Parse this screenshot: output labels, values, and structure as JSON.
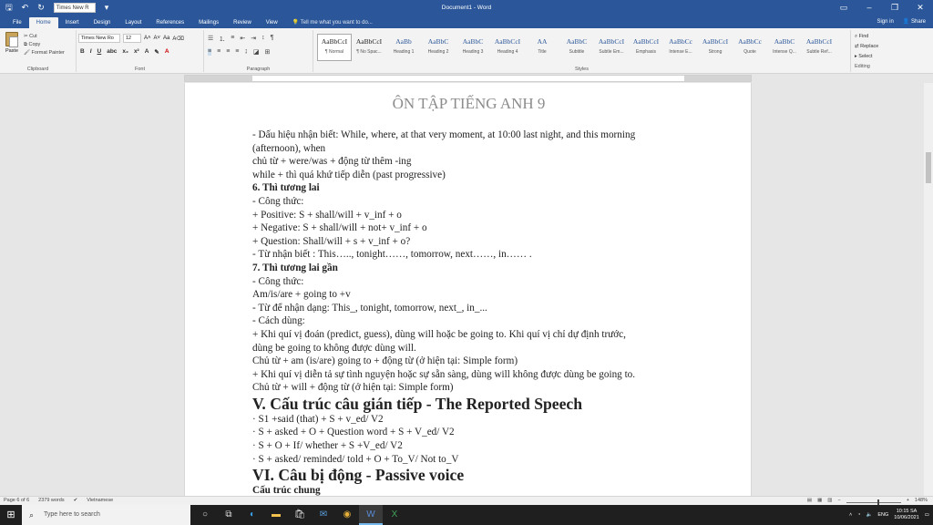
{
  "titlebar": {
    "font_box": "Times New R",
    "doc_title": "Document1 - Word"
  },
  "tabs": [
    "File",
    "Home",
    "Insert",
    "Design",
    "Layout",
    "References",
    "Mailings",
    "Review",
    "View"
  ],
  "tell_me": "Tell me what you want to do...",
  "account": {
    "signin": "Sign in",
    "share": "Share"
  },
  "ribbon": {
    "clipboard": {
      "paste": "Paste",
      "cut": "Cut",
      "copy": "Copy",
      "format_painter": "Format Painter",
      "label": "Clipboard"
    },
    "font": {
      "name": "Times New Ro",
      "size": "12",
      "label": "Font",
      "bold": "B",
      "italic": "I",
      "underline": "U"
    },
    "paragraph": {
      "label": "Paragraph"
    },
    "styles": {
      "label": "Styles",
      "items": [
        {
          "sample": "AaBbCcI",
          "name": "¶ Normal"
        },
        {
          "sample": "AaBbCcI",
          "name": "¶ No Spac..."
        },
        {
          "sample": "AaBb",
          "name": "Heading 1"
        },
        {
          "sample": "AaBbC",
          "name": "Heading 2"
        },
        {
          "sample": "AaBbC",
          "name": "Heading 3"
        },
        {
          "sample": "AaBbCcI",
          "name": "Heading 4"
        },
        {
          "sample": "AA",
          "name": "Title"
        },
        {
          "sample": "AaBbC",
          "name": "Subtitle"
        },
        {
          "sample": "AaBbCcI",
          "name": "Subtle Em..."
        },
        {
          "sample": "AaBbCcI",
          "name": "Emphasis"
        },
        {
          "sample": "AaBbCc",
          "name": "Intense E..."
        },
        {
          "sample": "AaBbCcI",
          "name": "Strong"
        },
        {
          "sample": "AaBbCc",
          "name": "Quote"
        },
        {
          "sample": "AaBbC",
          "name": "Intense Q..."
        },
        {
          "sample": "AaBbCcI",
          "name": "Subtle Ref..."
        }
      ]
    },
    "editing": {
      "find": "Find",
      "replace": "Replace",
      "select": "Select",
      "label": "Editing"
    }
  },
  "document": {
    "header": "ÔN TẬP TIẾNG ANH 9",
    "lines": [
      {
        "text": "- Dấu hiệu nhận biết: While, where, at that very moment, at 10:00 last night, and this morning",
        "style": ""
      },
      {
        "text": "(afternoon), when",
        "style": ""
      },
      {
        "text": "chủ từ + were/was + động từ thêm -ing",
        "style": ""
      },
      {
        "text": "while + thì quá khứ tiếp diễn (past progressive)",
        "style": ""
      },
      {
        "text": "6. Thì tương lai",
        "style": "bold"
      },
      {
        "text": "- Công thức:",
        "style": ""
      },
      {
        "text": "+ Positive: S + shall/will + v_inf + o",
        "style": ""
      },
      {
        "text": "+ Negative: S + shall/will + not+ v_inf + o",
        "style": ""
      },
      {
        "text": "+ Question: Shall/will + s + v_inf + o?",
        "style": ""
      },
      {
        "text": "- Từ nhận biết : This….., tonight……, tomorrow, next……, in…… .",
        "style": ""
      },
      {
        "text": "7. Thì tương lai gần",
        "style": "bold"
      },
      {
        "text": "- Công thức:",
        "style": ""
      },
      {
        "text": "Am/is/are + going to +v",
        "style": ""
      },
      {
        "text": "- Từ để nhận dạng: This_, tonight, tomorrow, next_, in_...",
        "style": ""
      },
      {
        "text": "- Cách dùng:",
        "style": ""
      },
      {
        "text": "+ Khi quí vị đoán (predict, guess), dùng will hoặc be going to. Khi quí vị chỉ dự định trước,",
        "style": ""
      },
      {
        "text": "dùng be going to không được dùng will.",
        "style": ""
      },
      {
        "text": "Chủ từ + am (is/are) going to + động từ (ở hiện tại: Simple form)",
        "style": ""
      },
      {
        "text": "+ Khi quí vị diễn tả sự tình nguyện hoặc sự sẵn sàng, dùng will không được dùng be going to.",
        "style": ""
      },
      {
        "text": "Chủ từ + will + động từ (ở hiện tại: Simple form)",
        "style": ""
      },
      {
        "text": "V. Cấu trúc câu gián tiếp - The Reported Speech",
        "style": "big"
      },
      {
        "text": "· S1 +said (that) + S + v_ed/ V2",
        "style": ""
      },
      {
        "text": "· S + asked + O + Question word + S + V_ed/ V2",
        "style": ""
      },
      {
        "text": "· S + O + If/ whether + S +V_ed/ V2",
        "style": ""
      },
      {
        "text": "· S + asked/ reminded/ told + O + To_V/ Not to_V",
        "style": ""
      },
      {
        "text": "VI. Câu bị động - Passive voice",
        "style": "big"
      },
      {
        "text": "Cấu trúc chung",
        "style": "bold"
      }
    ]
  },
  "statusbar": {
    "page": "Page 6 of 6",
    "words": "2379 words",
    "language": "Vietnamese",
    "zoom": "148%"
  },
  "taskbar": {
    "search_placeholder": "Type here to search",
    "language": "ENG",
    "time": "10:15 SA",
    "date": "10/06/2021"
  }
}
